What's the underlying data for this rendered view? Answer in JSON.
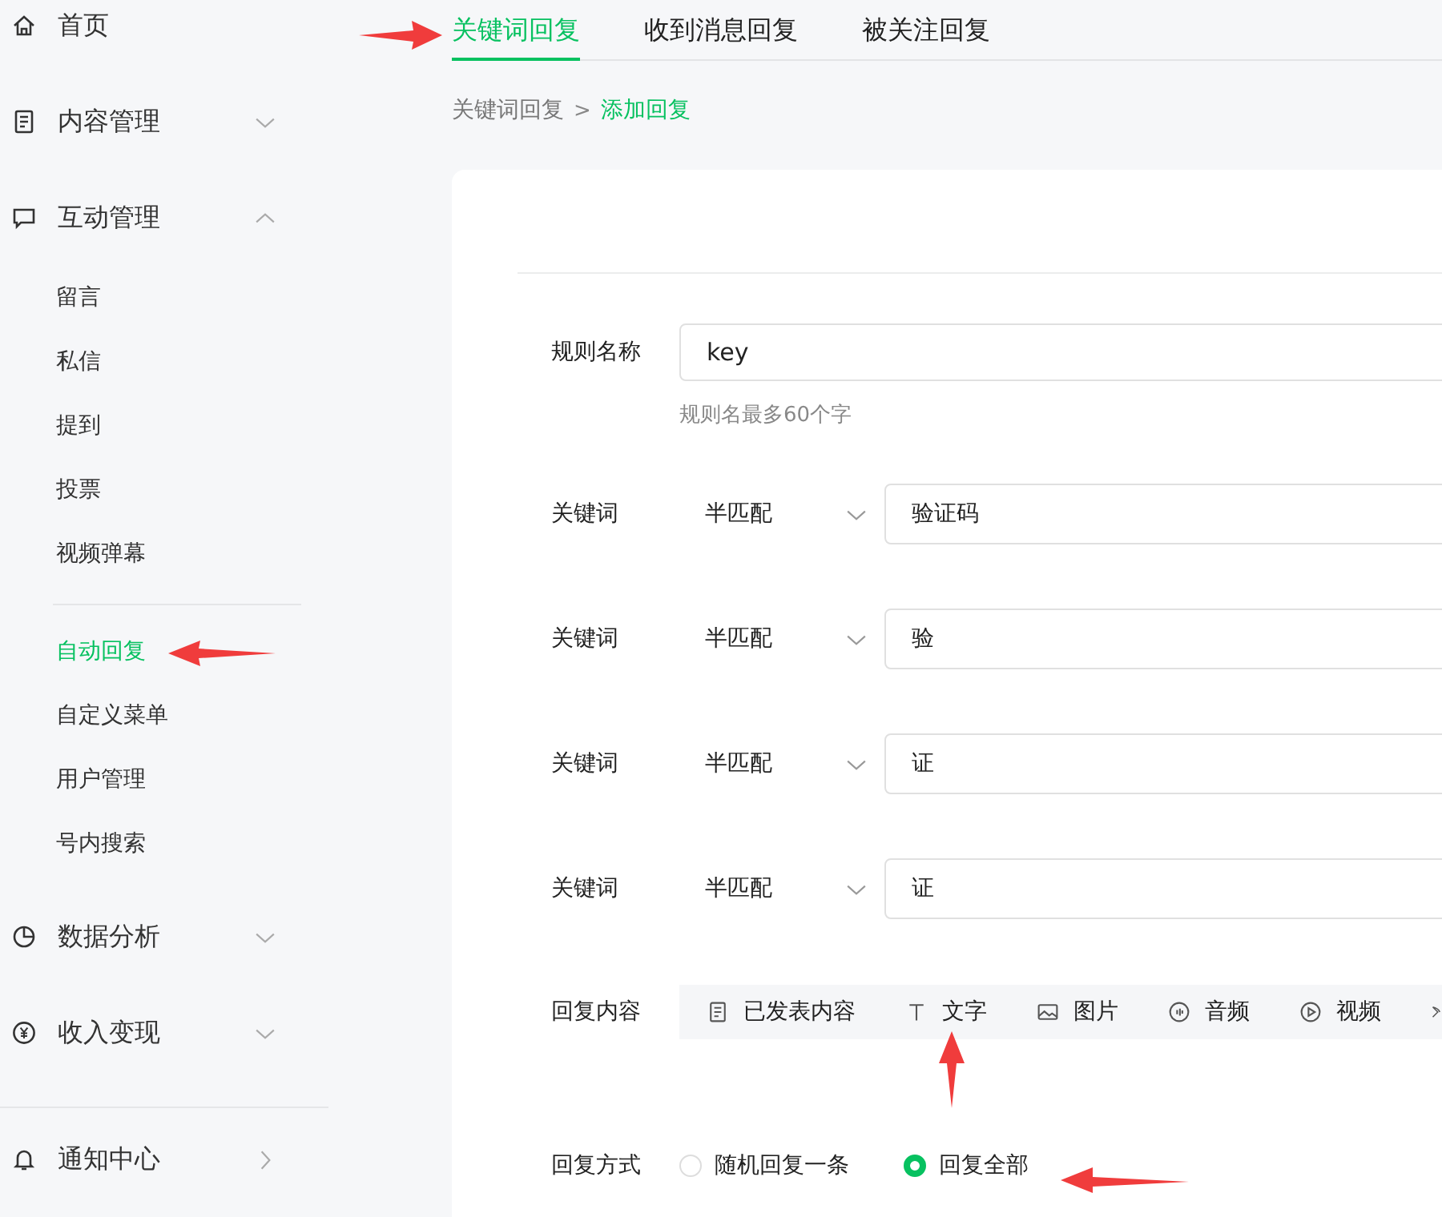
{
  "sidebar": {
    "items": [
      {
        "kind": "home",
        "label": "首页"
      },
      {
        "kind": "document",
        "label": "内容管理",
        "expanded": false
      },
      {
        "kind": "chat",
        "label": "互动管理",
        "expanded": true,
        "children": [
          {
            "label": "留言",
            "selected": false,
            "divider_before": false
          },
          {
            "label": "私信",
            "selected": false,
            "divider_before": false
          },
          {
            "label": "提到",
            "selected": false,
            "divider_before": false
          },
          {
            "label": "投票",
            "selected": false,
            "divider_before": false
          },
          {
            "label": "视频弹幕",
            "selected": false,
            "divider_before": false
          },
          {
            "label": "自动回复",
            "selected": true,
            "divider_before": true
          },
          {
            "label": "自定义菜单",
            "selected": false,
            "divider_before": false
          },
          {
            "label": "用户管理",
            "selected": false,
            "divider_before": false
          },
          {
            "label": "号内搜索",
            "selected": false,
            "divider_before": false
          }
        ]
      },
      {
        "kind": "chart",
        "label": "数据分析",
        "expanded": false
      },
      {
        "kind": "money",
        "label": "收入变现",
        "expanded": false
      },
      {
        "kind": "bell",
        "label": "通知中心",
        "link": true,
        "divider_before": true
      }
    ]
  },
  "tabs": [
    {
      "label": "关键词回复",
      "selected": true
    },
    {
      "label": "收到消息回复",
      "selected": false
    },
    {
      "label": "被关注回复",
      "selected": false
    }
  ],
  "breadcrumb": {
    "parent": "关键词回复",
    "separator": ">",
    "current": "添加回复"
  },
  "rule_name": {
    "label": "规则名称",
    "value": "key",
    "hint": "规则名最多60个字"
  },
  "keywords": [
    {
      "label": "关键词",
      "match": "半匹配",
      "value": "验证码"
    },
    {
      "label": "关键词",
      "match": "半匹配",
      "value": "验"
    },
    {
      "label": "关键词",
      "match": "半匹配",
      "value": "证"
    },
    {
      "label": "关键词",
      "match": "半匹配",
      "value": "证"
    }
  ],
  "reply_content": {
    "label": "回复内容",
    "options": [
      {
        "kind": "document",
        "label": "已发表内容"
      },
      {
        "kind": "text",
        "label": "文字"
      },
      {
        "kind": "image",
        "label": "图片"
      },
      {
        "kind": "audio",
        "label": "音频"
      },
      {
        "kind": "video",
        "label": "视频"
      },
      {
        "kind": "clipped"
      }
    ]
  },
  "reply_mode": {
    "label": "回复方式",
    "options": [
      {
        "label": "随机回复一条",
        "selected": false
      },
      {
        "label": "回复全部",
        "selected": true
      }
    ]
  }
}
